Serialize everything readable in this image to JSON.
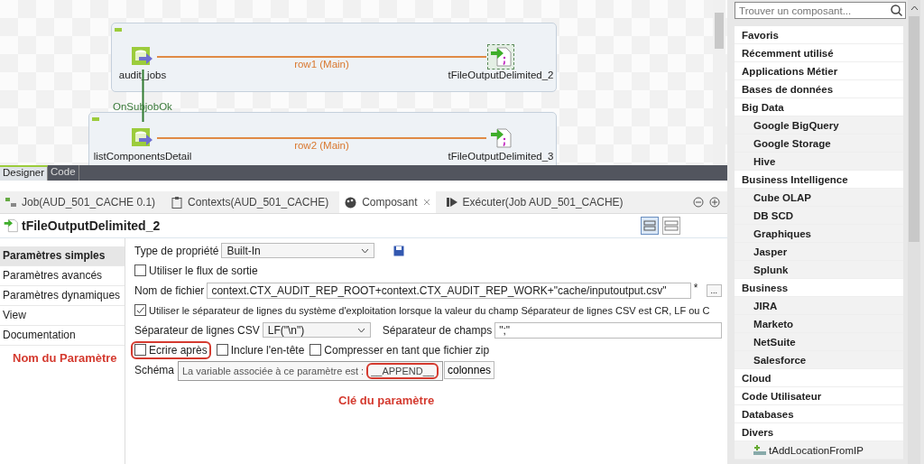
{
  "designer": {
    "subjobs": [
      {
        "nodes": [
          {
            "label": "audit_jobs",
            "kind": "input",
            "selected": false
          },
          {
            "label": "tFileOutputDelimited_2",
            "kind": "output",
            "selected": true
          }
        ],
        "link": "row1 (Main)"
      },
      {
        "nodes": [
          {
            "label": "listComponentsDetail",
            "kind": "input",
            "selected": false
          },
          {
            "label": "tFileOutputDelimited_3",
            "kind": "output",
            "selected": false
          }
        ],
        "link": "row2 (Main)"
      }
    ],
    "trigger": "OnSubjobOk",
    "tabs": [
      {
        "label": "Designer",
        "selected": true
      },
      {
        "label": "Code",
        "selected": false
      }
    ]
  },
  "panel": {
    "tabs": [
      {
        "label": "Job(AUD_501_CACHE 0.1)",
        "kind": "job",
        "selected": false
      },
      {
        "label": "Contexts(AUD_501_CACHE)",
        "kind": "contexts",
        "selected": false
      },
      {
        "label": "Composant",
        "kind": "component",
        "selected": true
      },
      {
        "label": "Exécuter(Job AUD_501_CACHE)",
        "kind": "run",
        "selected": false
      }
    ],
    "component_title": "tFileOutputDelimited_2",
    "nav": [
      {
        "label": "Paramètres simples",
        "selected": true
      },
      {
        "label": "Paramètres avancés",
        "selected": false
      },
      {
        "label": "Paramètres dynamiques",
        "selected": false
      },
      {
        "label": "View",
        "selected": false
      },
      {
        "label": "Documentation",
        "selected": false
      }
    ],
    "form": {
      "property_type": {
        "label": "Type de propriété",
        "value": "Built-In"
      },
      "use_output_stream": {
        "label": "Utiliser le flux de sortie",
        "checked": false
      },
      "file_name": {
        "label": "Nom de fichier",
        "value": "context.CTX_AUDIT_REP_ROOT+context.CTX_AUDIT_REP_WORK+\"cache/inputoutput.csv\"",
        "required_mark": "*",
        "browse": "..."
      },
      "os_separator": {
        "label": "Utiliser le séparateur de lignes du système d'exploitation lorsque la valeur du champ Séparateur de lignes CSV est  CR, LF ou C",
        "checked": true
      },
      "row_separator": {
        "label": "Séparateur de lignes CSV",
        "value": "LF(\"\\n\")"
      },
      "field_separator": {
        "label": "Séparateur de champs",
        "value": "\";\""
      },
      "options": [
        {
          "label": "Ecrire après",
          "checked": false,
          "highlighted": true
        },
        {
          "label": "Inclure l'en-tête",
          "checked": false,
          "highlighted": false
        },
        {
          "label": "Compresser en tant que fichier zip",
          "checked": false,
          "highlighted": false
        }
      ],
      "schema": {
        "label": "Schéma",
        "button": "colonnes"
      },
      "tooltip": {
        "text": "La variable associée à ce paramètre est :",
        "key": "__APPEND__"
      }
    }
  },
  "annotations": {
    "parameter_name": "Nom du Paramètre",
    "parameter_key": "Clé du paramètre"
  },
  "palette": {
    "search": {
      "placeholder": "Trouver un composant..."
    },
    "items": [
      {
        "label": "Favoris",
        "kind": "category"
      },
      {
        "label": "Récemment utilisé",
        "kind": "category"
      },
      {
        "label": "Applications Métier",
        "kind": "category"
      },
      {
        "label": "Bases de données",
        "kind": "category"
      },
      {
        "label": "Big Data",
        "kind": "category",
        "children": [
          {
            "label": "Google BigQuery",
            "kind": "category"
          },
          {
            "label": "Google Storage",
            "kind": "category"
          },
          {
            "label": "Hive",
            "kind": "category"
          }
        ]
      },
      {
        "label": "Business Intelligence",
        "kind": "category",
        "children": [
          {
            "label": "Cube OLAP",
            "kind": "category"
          },
          {
            "label": "DB SCD",
            "kind": "category"
          },
          {
            "label": "Graphiques",
            "kind": "category"
          },
          {
            "label": "Jasper",
            "kind": "category"
          },
          {
            "label": "Splunk",
            "kind": "category"
          }
        ]
      },
      {
        "label": "Business",
        "kind": "category",
        "children": [
          {
            "label": "JIRA",
            "kind": "category"
          },
          {
            "label": "Marketo",
            "kind": "category"
          },
          {
            "label": "NetSuite",
            "kind": "category"
          },
          {
            "label": "Salesforce",
            "kind": "category"
          }
        ]
      },
      {
        "label": "Cloud",
        "kind": "category"
      },
      {
        "label": "Code Utilisateur",
        "kind": "category"
      },
      {
        "label": "Databases",
        "kind": "category"
      },
      {
        "label": "Divers",
        "kind": "category",
        "children": [
          {
            "label": "tAddLocationFromIP",
            "kind": "component"
          }
        ]
      }
    ]
  }
}
